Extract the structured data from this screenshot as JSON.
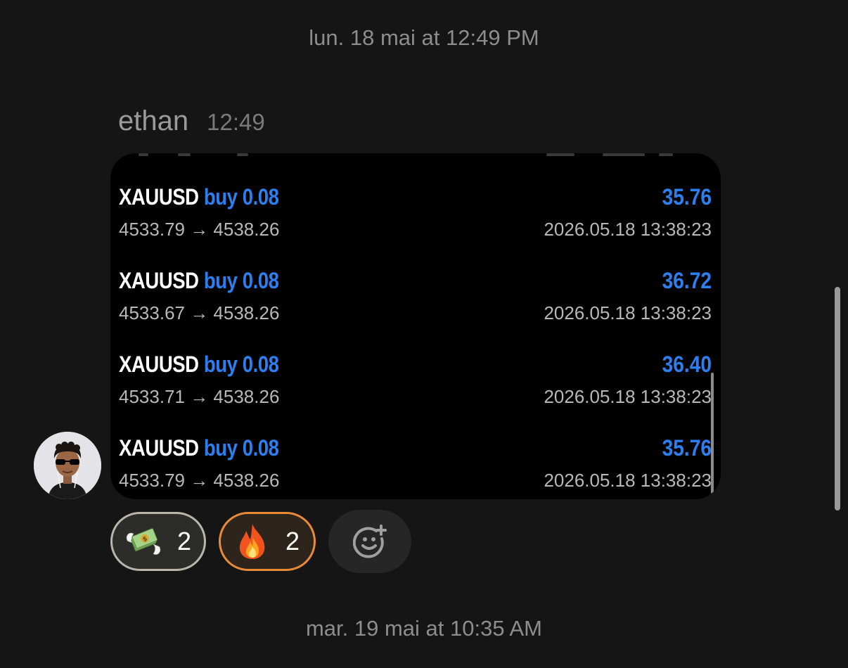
{
  "date_separators": {
    "top": {
      "day": "lun. 18 mai",
      "connector": "at",
      "time": "12:49 PM"
    },
    "bottom": {
      "day": "mar. 19 mai",
      "connector": "at",
      "time": "10:35 AM"
    }
  },
  "message": {
    "author": "ethan",
    "time": "12:49",
    "trades": [
      {
        "symbol": "XAUUSD",
        "side": "buy 0.08",
        "profit": "35.76",
        "prices": "4533.79 → 4538.26",
        "datetime": "2026.05.18 13:38:23"
      },
      {
        "symbol": "XAUUSD",
        "side": "buy 0.08",
        "profit": "36.72",
        "prices": "4533.67 → 4538.26",
        "datetime": "2026.05.18 13:38:23"
      },
      {
        "symbol": "XAUUSD",
        "side": "buy 0.08",
        "profit": "36.40",
        "prices": "4533.71 → 4538.26",
        "datetime": "2026.05.18 13:38:23"
      },
      {
        "symbol": "XAUUSD",
        "side": "buy 0.08",
        "profit": "35.76",
        "prices": "4533.79 → 4538.26",
        "datetime": "2026.05.18 13:38:23"
      }
    ],
    "reactions": [
      {
        "emoji": "money-with-wings",
        "count": "2"
      },
      {
        "emoji": "fire",
        "count": "2"
      }
    ],
    "add_reaction_icon": "add-reaction-icon"
  },
  "colors": {
    "background": "#151515",
    "card": "#000000",
    "accent_blue": "#2d7ff0",
    "fire_border": "#e98a36"
  }
}
